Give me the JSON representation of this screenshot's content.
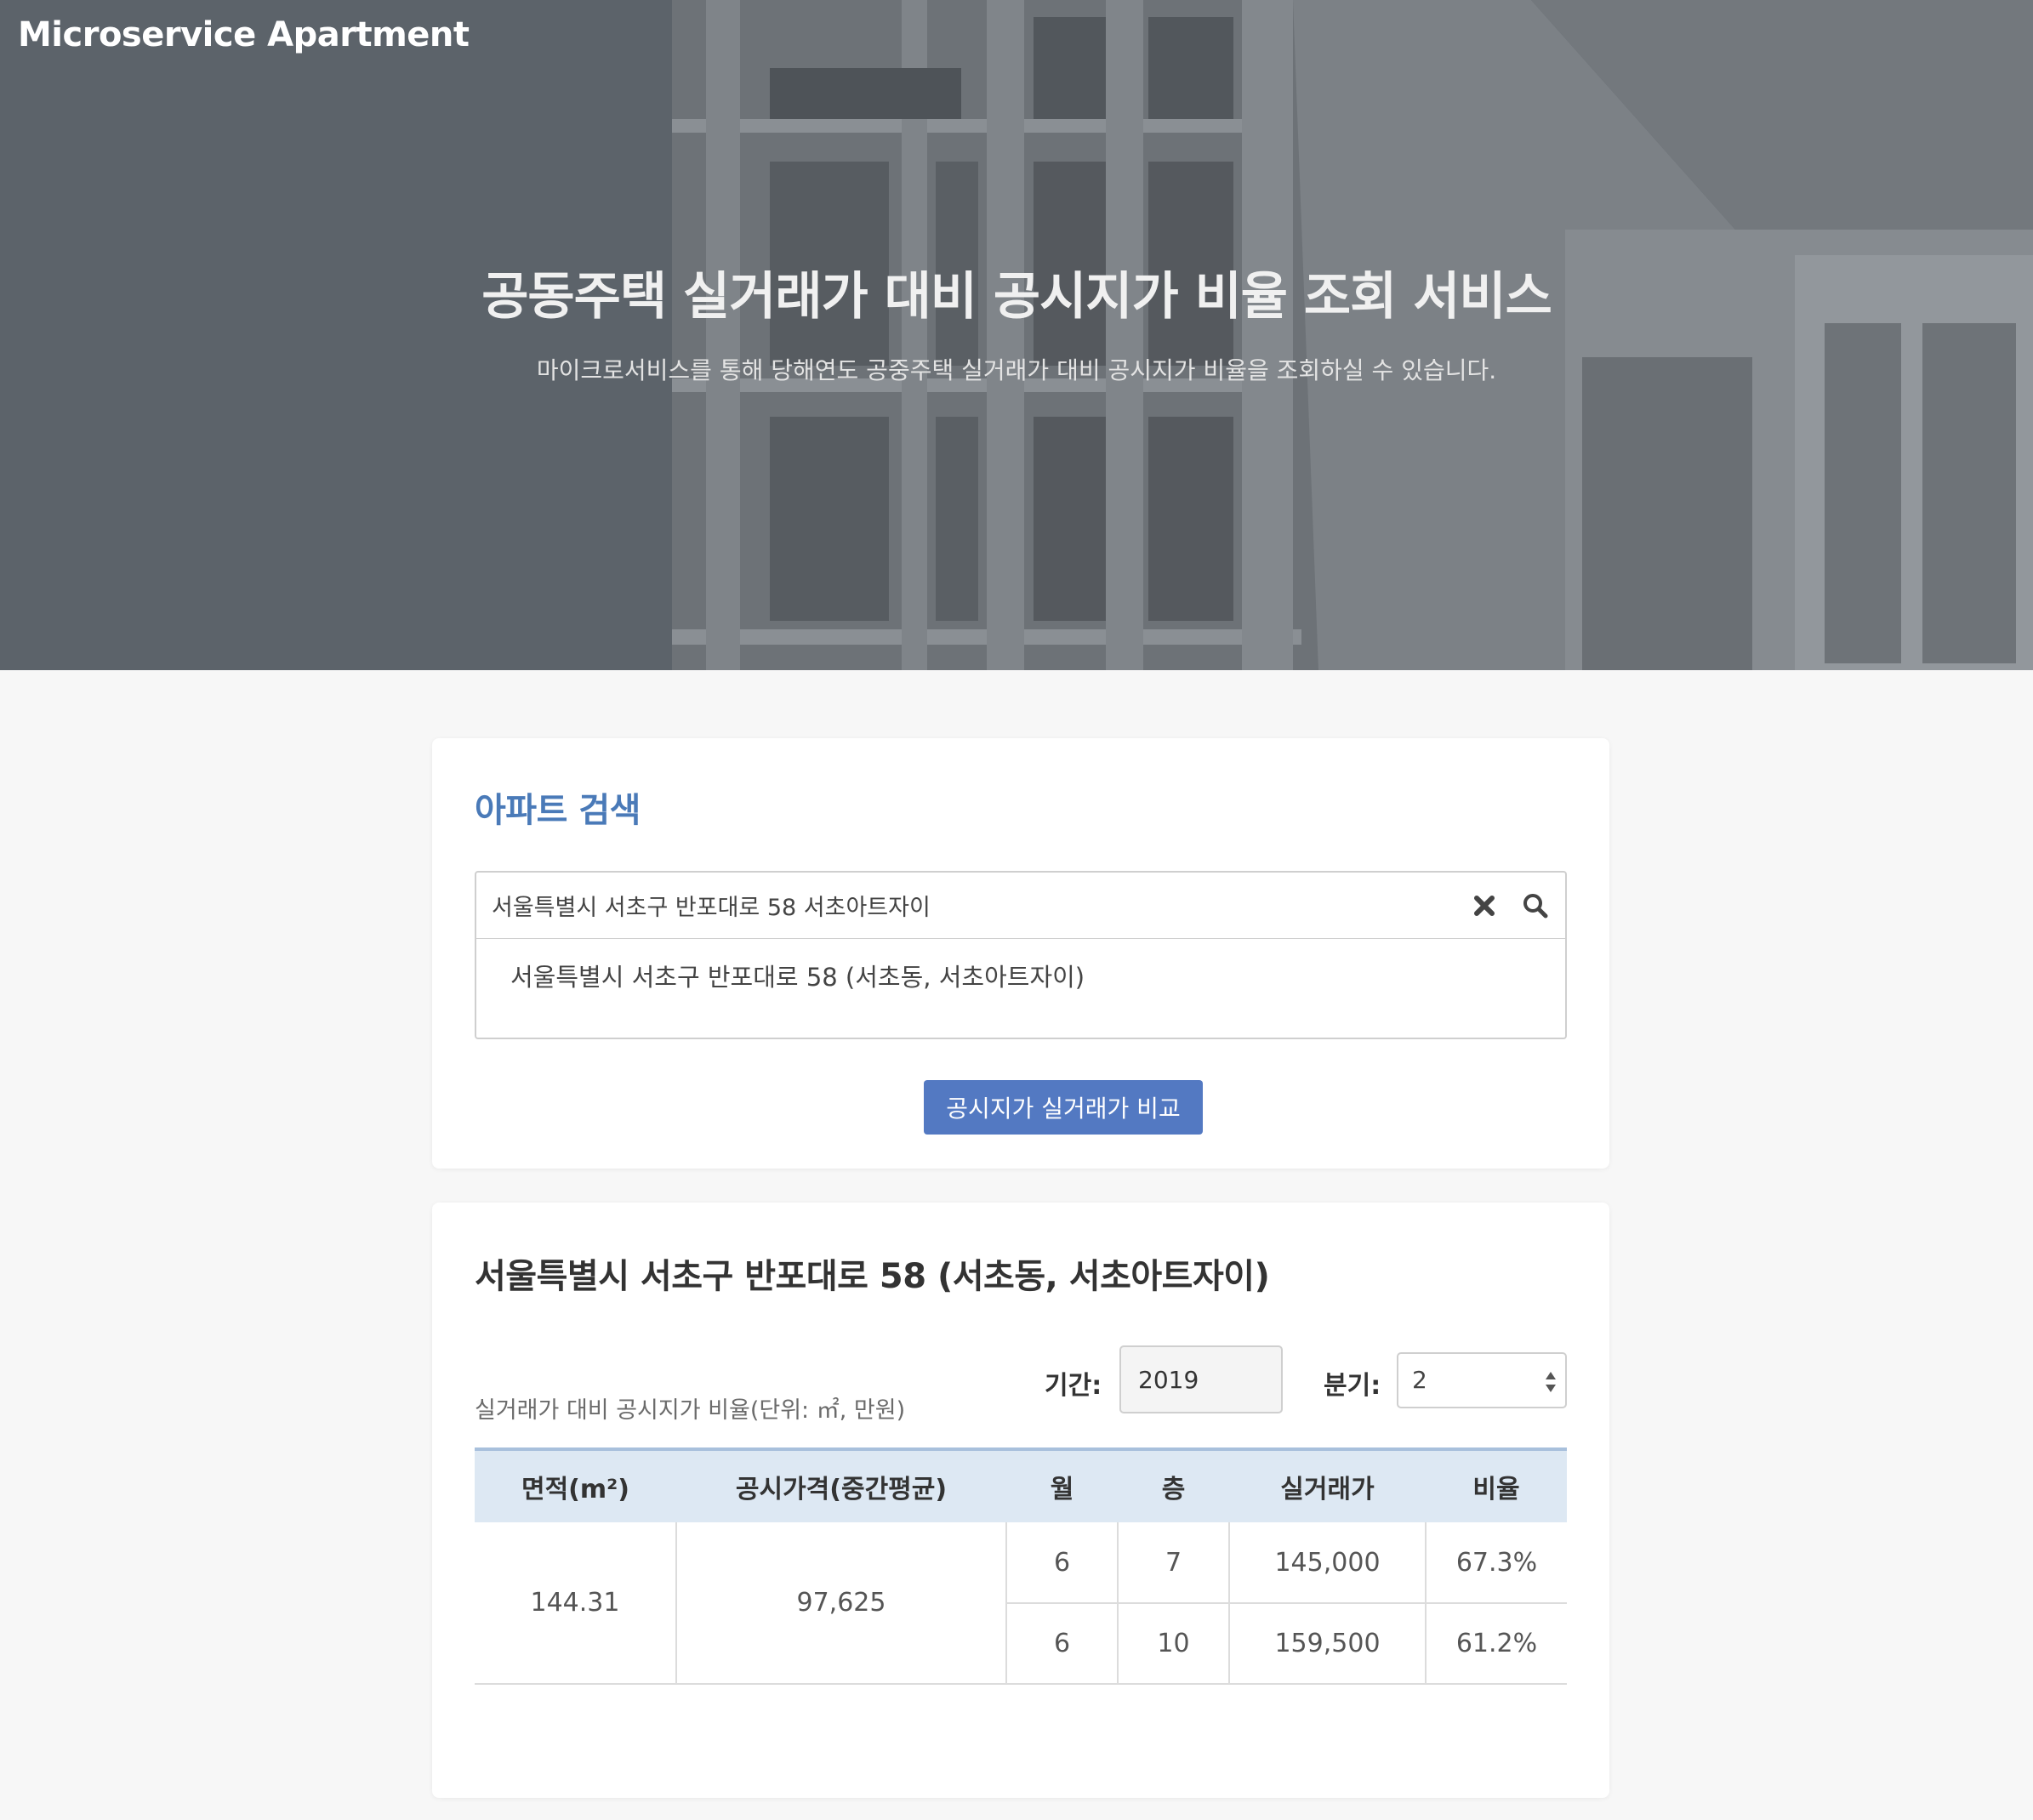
{
  "brand": "Microservice Apartment",
  "hero": {
    "title": "공동주택 실거래가 대비 공시지가 비율 조회 서비스",
    "subtitle": "마이크로서비스를 통해 당해연도 공중주택 실거래가 대비 공시지가 비율을 조회하실 수 있습니다."
  },
  "search": {
    "heading": "아파트 검색",
    "query": "서울특별시 서초구 반포대로 58 서초아트자이",
    "suggestion": "서울특별시 서초구 반포대로 58 (서초동, 서초아트자이)",
    "compare_label": "공시지가 실거래가 비교",
    "icons": {
      "clear": "close-icon",
      "search": "search-icon"
    }
  },
  "result": {
    "title": "서울특별시 서초구 반포대로 58 (서초동, 서초아트자이)",
    "unit_caption": "실거래가 대비 공시지가 비율(단위: ㎡, 만원)",
    "period_label": "기간:",
    "period_value": "2019",
    "quarter_label": "분기:",
    "quarter_value": "2",
    "table": {
      "headers": [
        "면적(m²)",
        "공시가격(중간평균)",
        "월",
        "층",
        "실거래가",
        "비율"
      ],
      "area": "144.31",
      "official_price": "97,625",
      "rows": [
        {
          "month": "6",
          "floor": "7",
          "price": "145,000",
          "ratio": "67.3%"
        },
        {
          "month": "6",
          "floor": "10",
          "price": "159,500",
          "ratio": "61.2%"
        }
      ]
    }
  },
  "colors": {
    "hero_bg": "#5c636a",
    "accent": "#4a7ab8",
    "button": "#5379c2",
    "table_header": "#dde8f3"
  }
}
